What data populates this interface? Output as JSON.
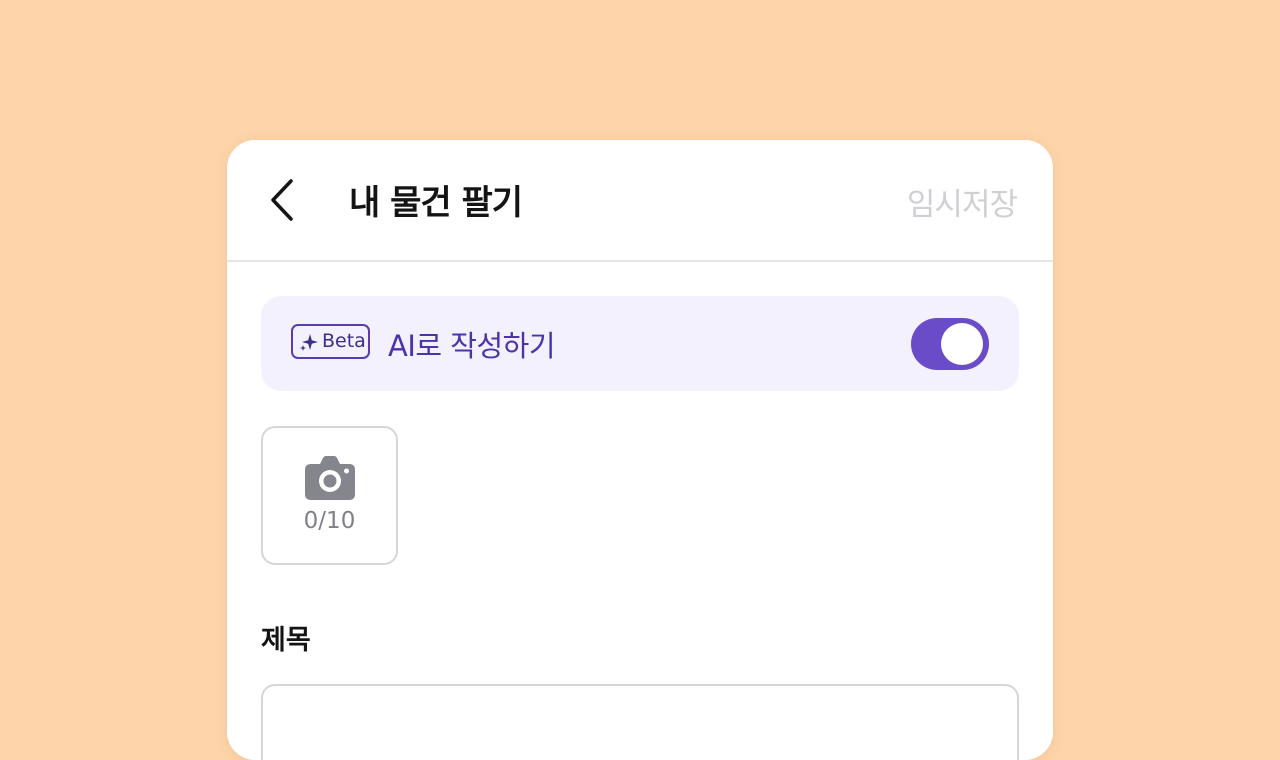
{
  "header": {
    "title": "내 물건 팔기",
    "save_draft_label": "임시저장"
  },
  "ai_banner": {
    "badge_label": "Beta",
    "label": "AI로 작성하기",
    "toggle_on": true
  },
  "photo_upload": {
    "count_text": "0/10",
    "icon": "camera-icon"
  },
  "title_section": {
    "label": "제목",
    "input_value": ""
  },
  "colors": {
    "background": "#FED5AA",
    "accent": "#6A4CC9",
    "banner_bg": "#F3F1FD"
  }
}
